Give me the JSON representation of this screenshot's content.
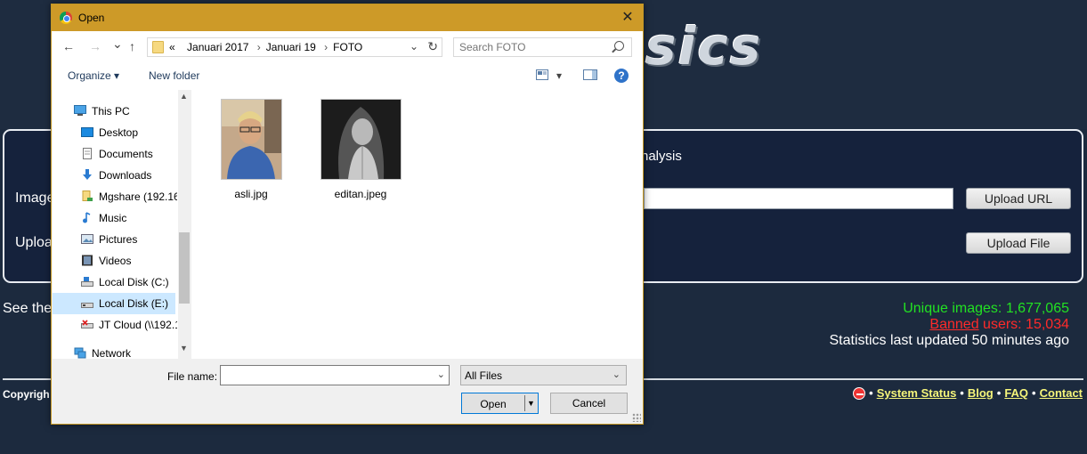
{
  "site": {
    "logo_text": "sics",
    "panel_heading": "nalysis",
    "image_label": "Image",
    "upload_label": "Uploa",
    "upload_url_button": "Upload URL",
    "upload_file_button": "Upload File",
    "see_text": "See the",
    "stats": {
      "unique": "Unique images: 1,677,065",
      "banned_word": "Banned",
      "banned_rest": " users: 15,034",
      "updated": "Statistics last updated 50 minutes ago"
    },
    "copyright": "Copyrigh",
    "footer": {
      "bullet": "•",
      "links": [
        "System Status",
        "Blog",
        "FAQ",
        "Contact"
      ]
    }
  },
  "dialog": {
    "title": "Open",
    "close_glyph": "✕",
    "nav": {
      "back": "←",
      "forward": "→",
      "recent": "⌄",
      "up": "↑"
    },
    "breadcrumb": {
      "prefix": "«",
      "parts": [
        "Januari 2017",
        "Januari 19",
        "FOTO"
      ]
    },
    "search_placeholder": "Search FOTO",
    "toolbar": {
      "organize": "Organize",
      "organize_caret": "▾",
      "new_folder": "New folder",
      "view_caret": "▾",
      "help": "?"
    },
    "nav_pane": [
      {
        "label": "This PC",
        "icon": "pc-icon"
      },
      {
        "label": "Desktop",
        "icon": "desktop-icon"
      },
      {
        "label": "Documents",
        "icon": "documents-icon"
      },
      {
        "label": "Downloads",
        "icon": "downloads-icon"
      },
      {
        "label": "Mgshare (192.16",
        "icon": "network-drive-icon"
      },
      {
        "label": "Music",
        "icon": "music-icon"
      },
      {
        "label": "Pictures",
        "icon": "pictures-icon"
      },
      {
        "label": "Videos",
        "icon": "videos-icon"
      },
      {
        "label": "Local Disk (C:)",
        "icon": "disk-icon"
      },
      {
        "label": "Local Disk (E:)",
        "icon": "disk-icon",
        "selected": true
      },
      {
        "label": "JT Cloud (\\\\192.1",
        "icon": "disconnected-drive-icon"
      },
      {
        "label": "Network",
        "icon": "network-icon"
      }
    ],
    "files": [
      {
        "name": "asli.jpg"
      },
      {
        "name": "editan.jpeg"
      }
    ],
    "file_name_label": "File name:",
    "file_name_value": "",
    "file_type": "All Files",
    "open_button": "Open",
    "cancel_button": "Cancel"
  },
  "colors": {
    "titlebar": "#cd9a28",
    "selected_item": "#cce8ff",
    "stat_unique": "#22e122",
    "stat_banned": "#ff2a2a",
    "footer_link": "#f5f57a"
  }
}
